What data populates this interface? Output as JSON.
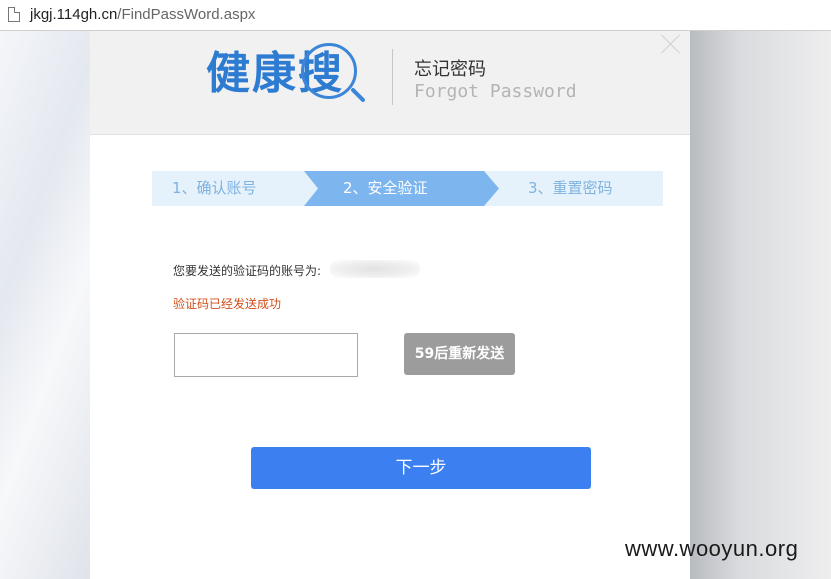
{
  "browser": {
    "url_host": "jkgj.114gh.cn",
    "url_path": "/FindPassWord.aspx"
  },
  "header": {
    "logo_text": "健康搜",
    "title": "忘记密码",
    "subtitle": "Forgot Password"
  },
  "steps": [
    {
      "label": "1、确认账号"
    },
    {
      "label": "2、安全验证"
    },
    {
      "label": "3、重置密码"
    }
  ],
  "active_step": 2,
  "verify": {
    "account_label": "您要发送的验证码的账号为:",
    "success_message": "验证码已经发送成功",
    "code_value": "",
    "resend_label": "59后重新发送"
  },
  "next_label": "下一步",
  "watermark": "www.wooyun.org",
  "icons": [
    "page-icon",
    "close-icon",
    "magnifier-icon"
  ],
  "colors": {
    "brand_blue": "#2e7bd2",
    "step_active": "#7db6ee",
    "step_inactive_bg": "#e6f2fb",
    "success_text": "#d0501c",
    "primary_button": "#3c7ff0",
    "disabled_button": "#9c9c9c"
  }
}
